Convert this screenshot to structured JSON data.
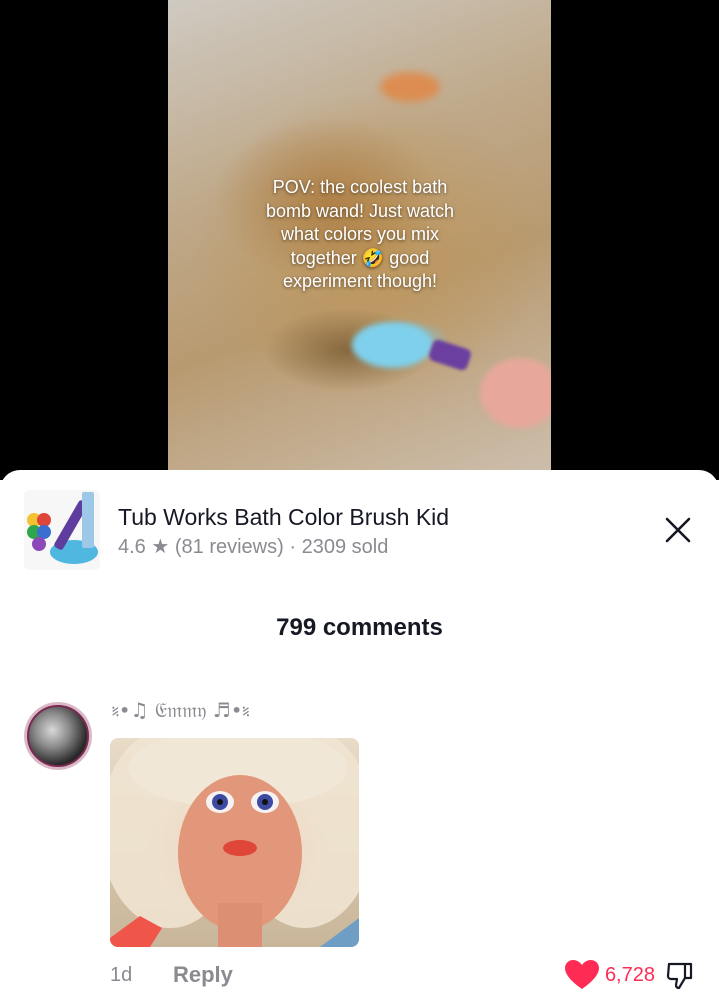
{
  "video": {
    "caption_lines": [
      "POV: the coolest bath",
      "bomb wand! Just watch",
      "what colors you mix",
      "together 🤣 good",
      "experiment though!"
    ]
  },
  "product": {
    "title": "Tub Works Bath Color Brush Kid",
    "rating": "4.6 ★",
    "reviews": "(81 reviews)",
    "separator": "·",
    "sold": "2309 sold",
    "thumbnail_icon": "product-thumbnail-image",
    "close_icon": "close-icon"
  },
  "comments_header": {
    "count_label": "799 comments"
  },
  "comment": {
    "username": "⹏•♫ 𝔈𝔪𝔪𝔶 ♬•⹏",
    "timestamp": "1d",
    "reply_label": "Reply",
    "like_count": "6,728",
    "like_color": "#fe2c55",
    "avatar_icon": "avatar",
    "image_icon": "comment-gif-image",
    "dislike_icon": "thumbs-down-icon"
  }
}
